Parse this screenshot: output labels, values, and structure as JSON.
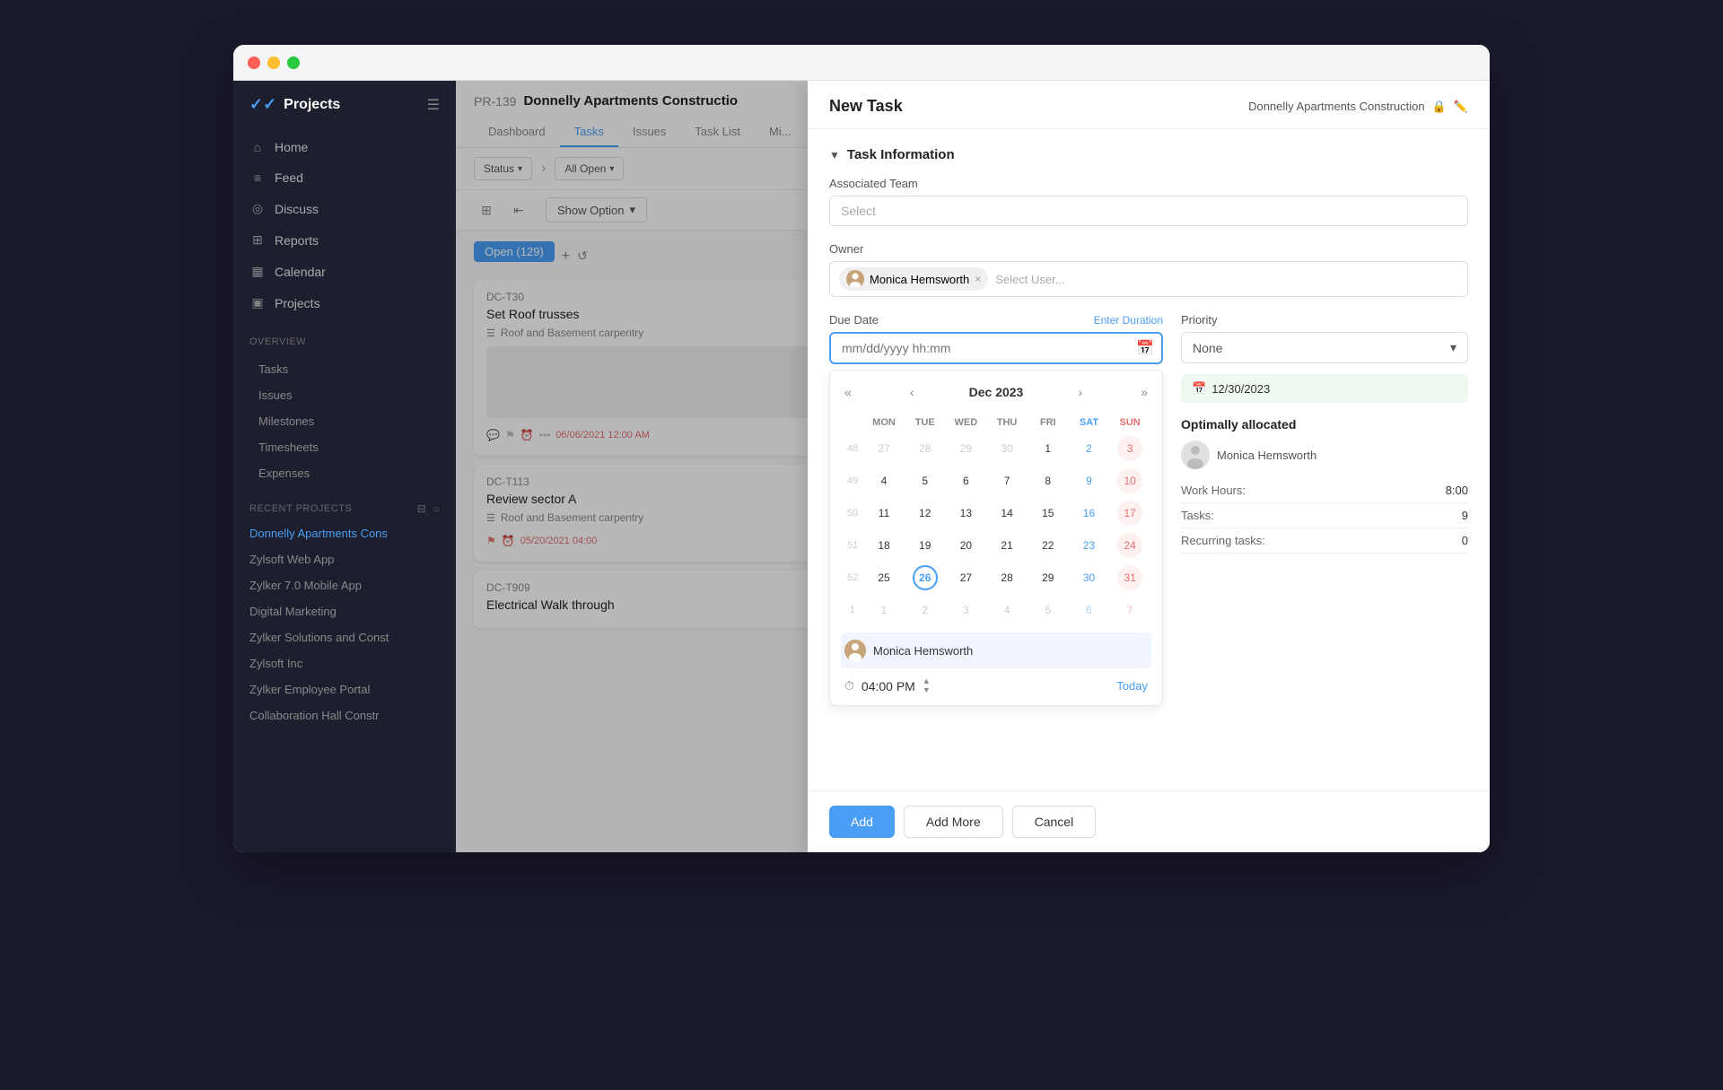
{
  "window": {
    "title": "Projects"
  },
  "sidebar": {
    "logo": "Projects",
    "nav_items": [
      {
        "label": "Home",
        "icon": "🏠"
      },
      {
        "label": "Feed",
        "icon": "📰"
      },
      {
        "label": "Discuss",
        "icon": "💬"
      },
      {
        "label": "Reports",
        "icon": "📊"
      },
      {
        "label": "Calendar",
        "icon": "📅"
      },
      {
        "label": "Projects",
        "icon": "📁"
      }
    ],
    "overview_section": "Overview",
    "sub_items": [
      {
        "label": "Tasks"
      },
      {
        "label": "Issues"
      },
      {
        "label": "Milestones"
      },
      {
        "label": "Timesheets"
      },
      {
        "label": "Expenses"
      }
    ],
    "recent_projects_label": "Recent Projects",
    "projects": [
      {
        "label": "Donnelly Apartments Cons",
        "active": true
      },
      {
        "label": "Zylsoft Web App"
      },
      {
        "label": "Zylker 7.0 Mobile App"
      },
      {
        "label": "Digital Marketing"
      },
      {
        "label": "Zylker Solutions and Const"
      },
      {
        "label": "Zylsoft Inc"
      },
      {
        "label": "Zylker Employee Portal"
      },
      {
        "label": "Collaboration Hall Constr"
      }
    ]
  },
  "project_header": {
    "id": "PR-139",
    "name": "Donnelly Apartments Constructio",
    "tabs": [
      "Dashboard",
      "Tasks",
      "Issues",
      "Task List",
      "Mi..."
    ],
    "active_tab": "Tasks",
    "status_label": "Status",
    "filter_label": "All Open"
  },
  "task_view": {
    "show_option": "Show Option",
    "open_badge": "Open (129)",
    "tasks": [
      {
        "id": "DC-T30",
        "title": "Set Roof trusses",
        "sub": "Roof and Basement carpentry",
        "date": "06/06/2021 12:00 AM",
        "has_thumbnail": true
      },
      {
        "id": "DC-T113",
        "title": "Review sector A",
        "sub": "Roof and Basement carpentry",
        "date": "05/20/2021 04:00",
        "has_thumbnail": false
      },
      {
        "id": "DC-T909",
        "title": "Electrical Walk through",
        "sub": "",
        "date": "",
        "has_thumbnail": false
      }
    ]
  },
  "modal": {
    "title": "New Task",
    "project_ref": "Donnelly Apartments Construction",
    "section_title": "Task Information",
    "associated_team_label": "Associated Team",
    "associated_team_placeholder": "Select",
    "owner_label": "Owner",
    "owner_name": "Monica Hemsworth",
    "owner_placeholder": "Select User...",
    "due_date_label": "Due Date",
    "enter_duration_link": "Enter Duration",
    "date_placeholder": "mm/dd/yyyy hh:mm",
    "calendar": {
      "month": "Dec 2023",
      "headers": [
        "MON",
        "TUE",
        "WED",
        "THU",
        "FRI",
        "SAT",
        "SUN"
      ],
      "weeks": [
        {
          "num": 48,
          "days": [
            {
              "d": "27",
              "cls": "other-month"
            },
            {
              "d": "28",
              "cls": "other-month"
            },
            {
              "d": "29",
              "cls": "other-month"
            },
            {
              "d": "30",
              "cls": "other-month"
            },
            {
              "d": "1"
            },
            {
              "d": "2",
              "cls": "sat"
            },
            {
              "d": "3",
              "cls": "sun highlighted"
            }
          ]
        },
        {
          "num": 49,
          "days": [
            {
              "d": "4"
            },
            {
              "d": "5"
            },
            {
              "d": "6"
            },
            {
              "d": "7"
            },
            {
              "d": "8"
            },
            {
              "d": "9",
              "cls": "sat"
            },
            {
              "d": "10",
              "cls": "sun highlighted"
            }
          ]
        },
        {
          "num": 50,
          "days": [
            {
              "d": "11"
            },
            {
              "d": "12"
            },
            {
              "d": "13"
            },
            {
              "d": "14"
            },
            {
              "d": "15"
            },
            {
              "d": "16",
              "cls": "sat"
            },
            {
              "d": "17",
              "cls": "sun highlighted"
            }
          ]
        },
        {
          "num": 51,
          "days": [
            {
              "d": "18"
            },
            {
              "d": "19"
            },
            {
              "d": "20"
            },
            {
              "d": "21"
            },
            {
              "d": "22"
            },
            {
              "d": "23",
              "cls": "sat"
            },
            {
              "d": "24",
              "cls": "sun highlighted"
            }
          ]
        },
        {
          "num": 52,
          "days": [
            {
              "d": "25"
            },
            {
              "d": "26",
              "cls": "today"
            },
            {
              "d": "27"
            },
            {
              "d": "28"
            },
            {
              "d": "29"
            },
            {
              "d": "30"
            },
            {
              "d": "31",
              "cls": "sun highlighted"
            }
          ]
        },
        {
          "num": 1,
          "days": [
            {
              "d": "1",
              "cls": "other-month"
            },
            {
              "d": "2",
              "cls": "other-month"
            },
            {
              "d": "3",
              "cls": "other-month"
            },
            {
              "d": "4",
              "cls": "other-month"
            },
            {
              "d": "5",
              "cls": "other-month"
            },
            {
              "d": "6",
              "cls": "other-month sat"
            },
            {
              "d": "7",
              "cls": "other-month sun"
            }
          ]
        }
      ],
      "user": "Monica Hemsworth",
      "time": "04:00 PM",
      "today_btn": "Today"
    },
    "priority_label": "Priority",
    "priority_value": "None",
    "date_suggestion": "12/30/2023",
    "optimal_title": "Optimally allocated",
    "optimal_user": "Monica Hemsworth",
    "work_hours_label": "Work Hours:",
    "work_hours_value": "8:00",
    "tasks_label": "Tasks:",
    "tasks_value": "9",
    "recurring_label": "Recurring tasks:",
    "recurring_value": "0",
    "add_btn": "Add",
    "add_more_btn": "Add More",
    "cancel_btn": "Cancel"
  }
}
